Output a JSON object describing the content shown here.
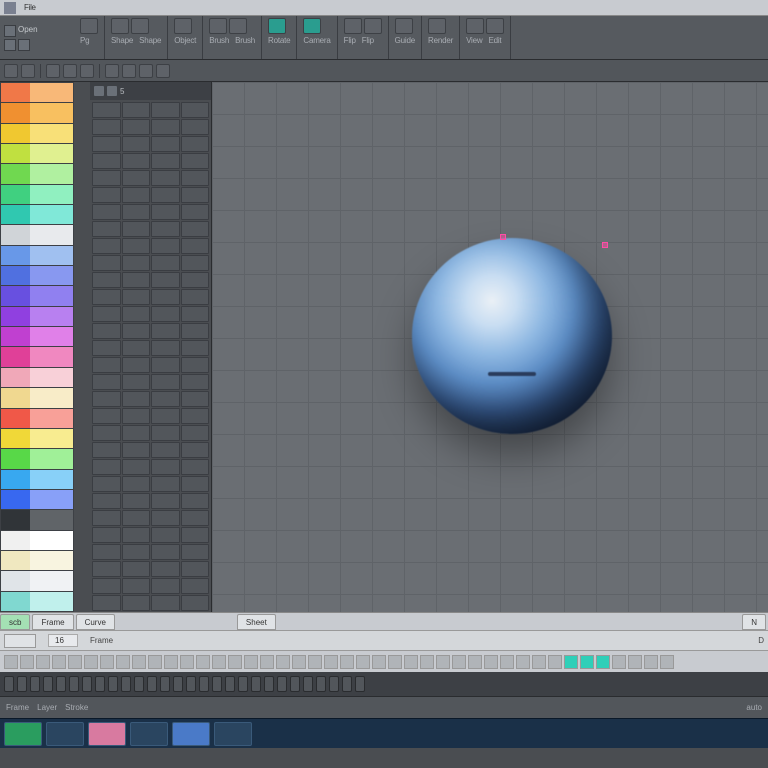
{
  "top_info": {
    "text": "File"
  },
  "toolbar1": {
    "file": {
      "open": "Open"
    },
    "groups": [
      {
        "labels": [
          "Pg"
        ]
      },
      {
        "labels": [
          "Shape",
          "Shape"
        ]
      },
      {
        "labels": [
          "Object"
        ]
      },
      {
        "labels": [
          "Brush",
          "Brush"
        ]
      },
      {
        "labels": [
          "Rotate"
        ]
      },
      {
        "labels": [
          "Camera"
        ]
      },
      {
        "labels": [
          "Flip",
          "Flip"
        ]
      },
      {
        "labels": [
          "Guide"
        ]
      },
      {
        "labels": [
          "Render"
        ]
      },
      {
        "labels": [
          "View",
          "Edit"
        ]
      }
    ]
  },
  "timeline": {
    "tab_scb": "scb",
    "tab_frame": "Frame",
    "tab_curve": "Curve",
    "tab_sheet": "Sheet",
    "tab_end": "N",
    "frame_label": "16",
    "bottom_label": "Frame",
    "dz_label": "D"
  },
  "status": {
    "left1": "Frame",
    "left2": "Layer",
    "mid": "Stroke",
    "right": "auto"
  },
  "palette_colors": [
    [
      "#f07848",
      "#f8b878"
    ],
    [
      "#f09030",
      "#f8c060"
    ],
    [
      "#f0c830",
      "#f8e078"
    ],
    [
      "#c0e040",
      "#e0f090"
    ],
    [
      "#70d850",
      "#b0f0a0"
    ],
    [
      "#40d080",
      "#90f0c0"
    ],
    [
      "#30c8b0",
      "#80e8d8"
    ],
    [
      "#d0d4d8",
      "#e8eaed"
    ],
    [
      "#6898e8",
      "#a0c0f0"
    ],
    [
      "#5070e0",
      "#8898f0"
    ],
    [
      "#6850e0",
      "#9080f0"
    ],
    [
      "#9040e0",
      "#b880f0"
    ],
    [
      "#c040d0",
      "#e080e8"
    ],
    [
      "#e04098",
      "#f088c0"
    ],
    [
      "#f0a8b8",
      "#f8d0d8"
    ],
    [
      "#f0d890",
      "#f8ecc8"
    ],
    [
      "#f05848",
      "#f8a098"
    ],
    [
      "#f0d838",
      "#f8ec90"
    ],
    [
      "#58d848",
      "#a0f098"
    ],
    [
      "#38a8f0",
      "#88d0f8"
    ],
    [
      "#3868f0",
      "#88a0f8"
    ],
    [
      "#303438",
      "#606468"
    ],
    [
      "#f0f0f0",
      "#ffffff"
    ],
    [
      "#f0e8c0",
      "#f8f4e0"
    ],
    [
      "#e0e4e8",
      "#f0f2f4"
    ],
    [
      "#80d8d0",
      "#c0f0ec"
    ]
  ]
}
